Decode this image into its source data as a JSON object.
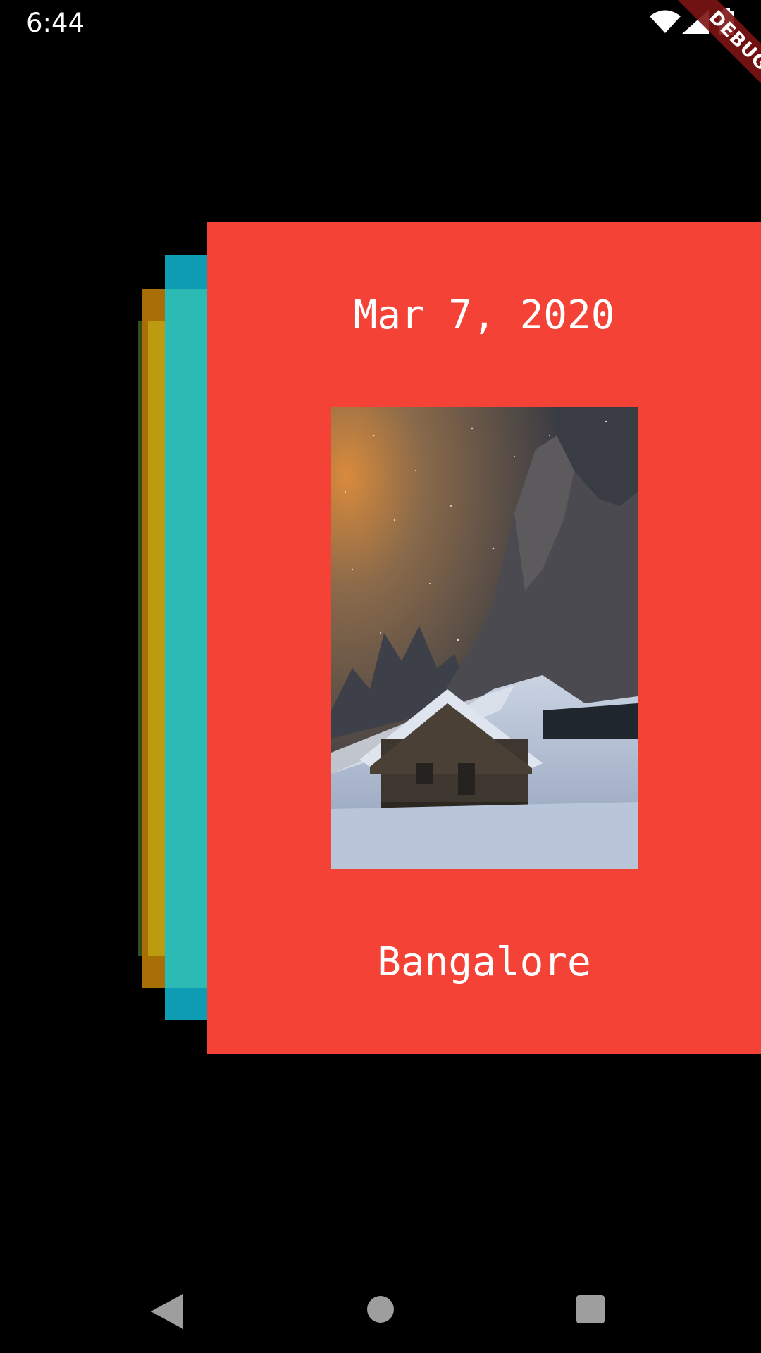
{
  "status_bar": {
    "time": "6:44",
    "icons": [
      "wifi-icon",
      "cellular-signal-icon",
      "battery-icon"
    ]
  },
  "debug_banner": {
    "label": "DEBUG",
    "color": "#7d1414"
  },
  "card": {
    "date": "Mar 7, 2020",
    "city": "Bangalore",
    "background_color": "#f44236",
    "photo_description_icon": "mountain-cabin-photo"
  },
  "stacked_cards": {
    "colors": [
      "#334d1f",
      "#a86f07",
      "#0e9cb4",
      "#f44236"
    ]
  },
  "navigation_bar": {
    "buttons": [
      "back-icon",
      "home-icon",
      "recents-icon"
    ]
  }
}
